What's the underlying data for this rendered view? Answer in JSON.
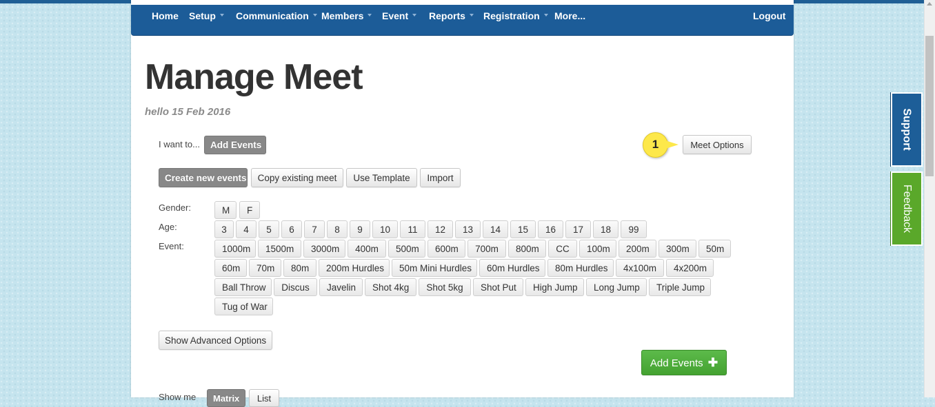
{
  "nav": {
    "items": [
      {
        "label": "Home",
        "caret": false
      },
      {
        "label": "Setup",
        "caret": true
      },
      {
        "label": "Communication",
        "caret": true
      },
      {
        "label": "Members",
        "caret": true
      },
      {
        "label": "Event",
        "caret": true
      },
      {
        "label": "Reports",
        "caret": true
      },
      {
        "label": "Registration",
        "caret": true
      },
      {
        "label": "More...",
        "caret": false
      }
    ],
    "logout": "Logout"
  },
  "page": {
    "title": "Manage Meet",
    "subtitle": "hello 15 Feb 2016"
  },
  "action": {
    "i_want_to": "I want to...",
    "selected": "Add Events",
    "meet_options": "Meet Options",
    "callout_number": "1"
  },
  "modes": [
    "Create new events",
    "Copy existing meet",
    "Use Template",
    "Import"
  ],
  "filters": {
    "gender_label": "Gender:",
    "age_label": "Age:",
    "event_label": "Event:",
    "genders": [
      "M",
      "F"
    ],
    "ages": [
      "3",
      "4",
      "5",
      "6",
      "7",
      "8",
      "9",
      "10",
      "11",
      "12",
      "13",
      "14",
      "15",
      "16",
      "17",
      "18",
      "99"
    ],
    "events_row1": [
      "1000m",
      "1500m",
      "3000m",
      "400m",
      "500m",
      "600m",
      "700m",
      "800m",
      "CC",
      "100m",
      "200m",
      "300m",
      "50m"
    ],
    "events_row2": [
      "60m",
      "70m",
      "80m",
      "200m Hurdles",
      "50m Mini Hurdles",
      "60m Hurdles",
      "80m Hurdles",
      "4x100m",
      "4x200m"
    ],
    "events_row3": [
      "Ball Throw",
      "Discus",
      "Javelin",
      "Shot 4kg",
      "Shot 5kg",
      "Shot Put",
      "High Jump",
      "Long Jump",
      "Triple Jump"
    ],
    "events_row4": [
      "Tug of War"
    ]
  },
  "advanced_button": "Show Advanced Options",
  "add_events_button": "Add Events",
  "add_icon": "plus-icon",
  "show_me": {
    "label": "Show me",
    "options": [
      "Matrix",
      "List"
    ]
  },
  "side_tabs": {
    "support": "Support",
    "feedback": "Feedback"
  },
  "colors": {
    "navbar": "#1c5c98",
    "support_tab": "#1d5e98",
    "feedback_tab": "#5aa82a",
    "add_button": "#4cae3b",
    "callout": "#fde84a"
  }
}
